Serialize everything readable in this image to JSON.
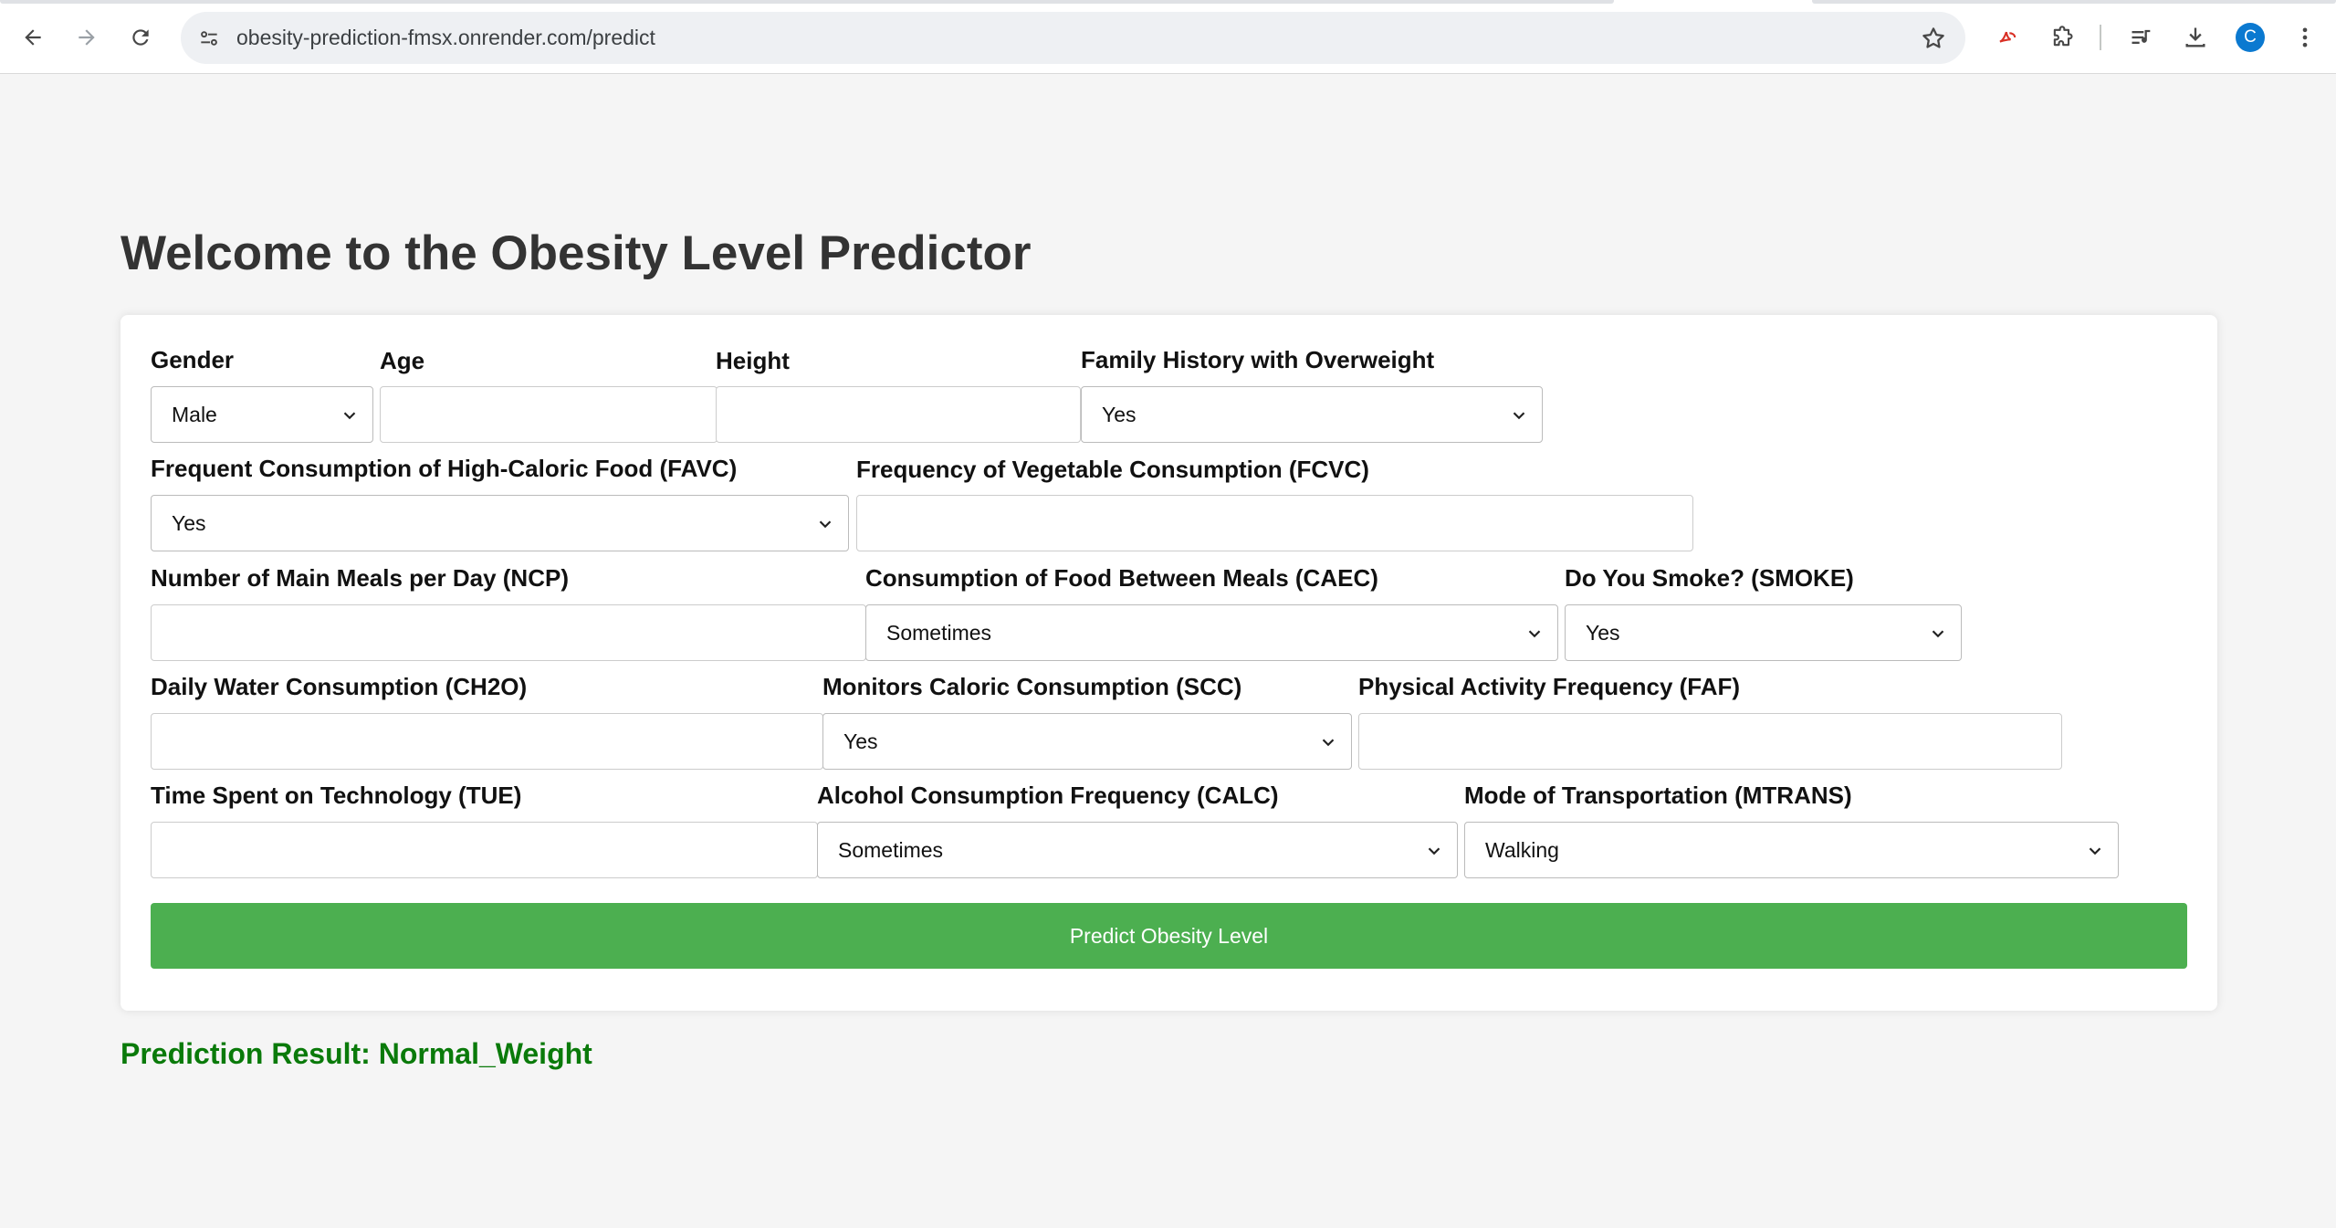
{
  "browser": {
    "url": "obesity-prediction-fmsx.onrender.com/predict",
    "profile_initial": "C",
    "icons": [
      "back-icon",
      "forward-icon",
      "reload-icon",
      "site-info-icon",
      "bookmark-star-icon",
      "extension-pdf-icon",
      "extensions-puzzle-icon",
      "media-queue-icon",
      "download-icon",
      "more-menu-icon"
    ]
  },
  "page": {
    "title": "Welcome to the Obesity Level Predictor"
  },
  "form": {
    "gender": {
      "label": "Gender",
      "value": "Male"
    },
    "age": {
      "label": "Age",
      "value": ""
    },
    "height": {
      "label": "Height",
      "value": ""
    },
    "family_history": {
      "label": "Family History with Overweight",
      "value": "Yes"
    },
    "favc": {
      "label": "Frequent Consumption of High-Caloric Food (FAVC)",
      "value": "Yes"
    },
    "fcvc": {
      "label": "Frequency of Vegetable Consumption (FCVC)",
      "value": ""
    },
    "ncp": {
      "label": "Number of Main Meals per Day (NCP)",
      "value": ""
    },
    "caec": {
      "label": "Consumption of Food Between Meals (CAEC)",
      "value": "Sometimes"
    },
    "smoke": {
      "label": "Do You Smoke? (SMOKE)",
      "value": "Yes"
    },
    "ch2o": {
      "label": "Daily Water Consumption (CH2O)",
      "value": ""
    },
    "scc": {
      "label": "Monitors Caloric Consumption (SCC)",
      "value": "Yes"
    },
    "faf": {
      "label": "Physical Activity Frequency (FAF)",
      "value": ""
    },
    "tue": {
      "label": "Time Spent on Technology (TUE)",
      "value": ""
    },
    "calc": {
      "label": "Alcohol Consumption Frequency (CALC)",
      "value": "Sometimes"
    },
    "mtrans": {
      "label": "Mode of Transportation (MTRANS)",
      "value": "Walking"
    },
    "submit_label": "Predict Obesity Level"
  },
  "result": {
    "text": "Prediction Result: Normal_Weight"
  },
  "colors": {
    "button": "#4caf50",
    "result": "#0a7a0a",
    "background": "#f5f5f5"
  }
}
